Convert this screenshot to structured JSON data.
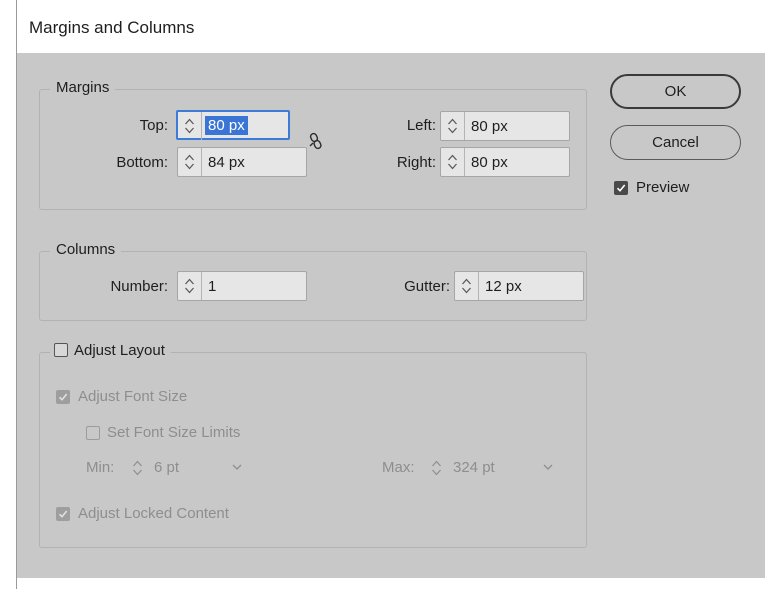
{
  "dialog": {
    "title": "Margins and Columns"
  },
  "margins": {
    "legend": "Margins",
    "top": {
      "label": "Top:",
      "value": "80 px"
    },
    "bottom": {
      "label": "Bottom:",
      "value": "84 px"
    },
    "left": {
      "label": "Left:",
      "value": "80 px"
    },
    "right": {
      "label": "Right:",
      "value": "80 px"
    },
    "link_icon": "chain-link-icon"
  },
  "columns": {
    "legend": "Columns",
    "number": {
      "label": "Number:",
      "value": "1"
    },
    "gutter": {
      "label": "Gutter:",
      "value": "12 px"
    }
  },
  "adjust_layout": {
    "label": "Adjust Layout",
    "checked": false,
    "adjust_font_size": {
      "label": "Adjust Font Size",
      "checked": true,
      "enabled": false
    },
    "set_font_size_limits": {
      "label": "Set Font Size Limits",
      "checked": false,
      "enabled": false
    },
    "min": {
      "label": "Min:",
      "value": "6 pt"
    },
    "max": {
      "label": "Max:",
      "value": "324 pt"
    },
    "adjust_locked_content": {
      "label": "Adjust Locked Content",
      "checked": true,
      "enabled": false
    }
  },
  "buttons": {
    "ok": "OK",
    "cancel": "Cancel"
  },
  "preview": {
    "label": "Preview",
    "checked": true
  },
  "colors": {
    "dialog_bg": "#c8c8c8",
    "selection": "#3a75d6",
    "focus_ring": "#3d7bd9"
  }
}
